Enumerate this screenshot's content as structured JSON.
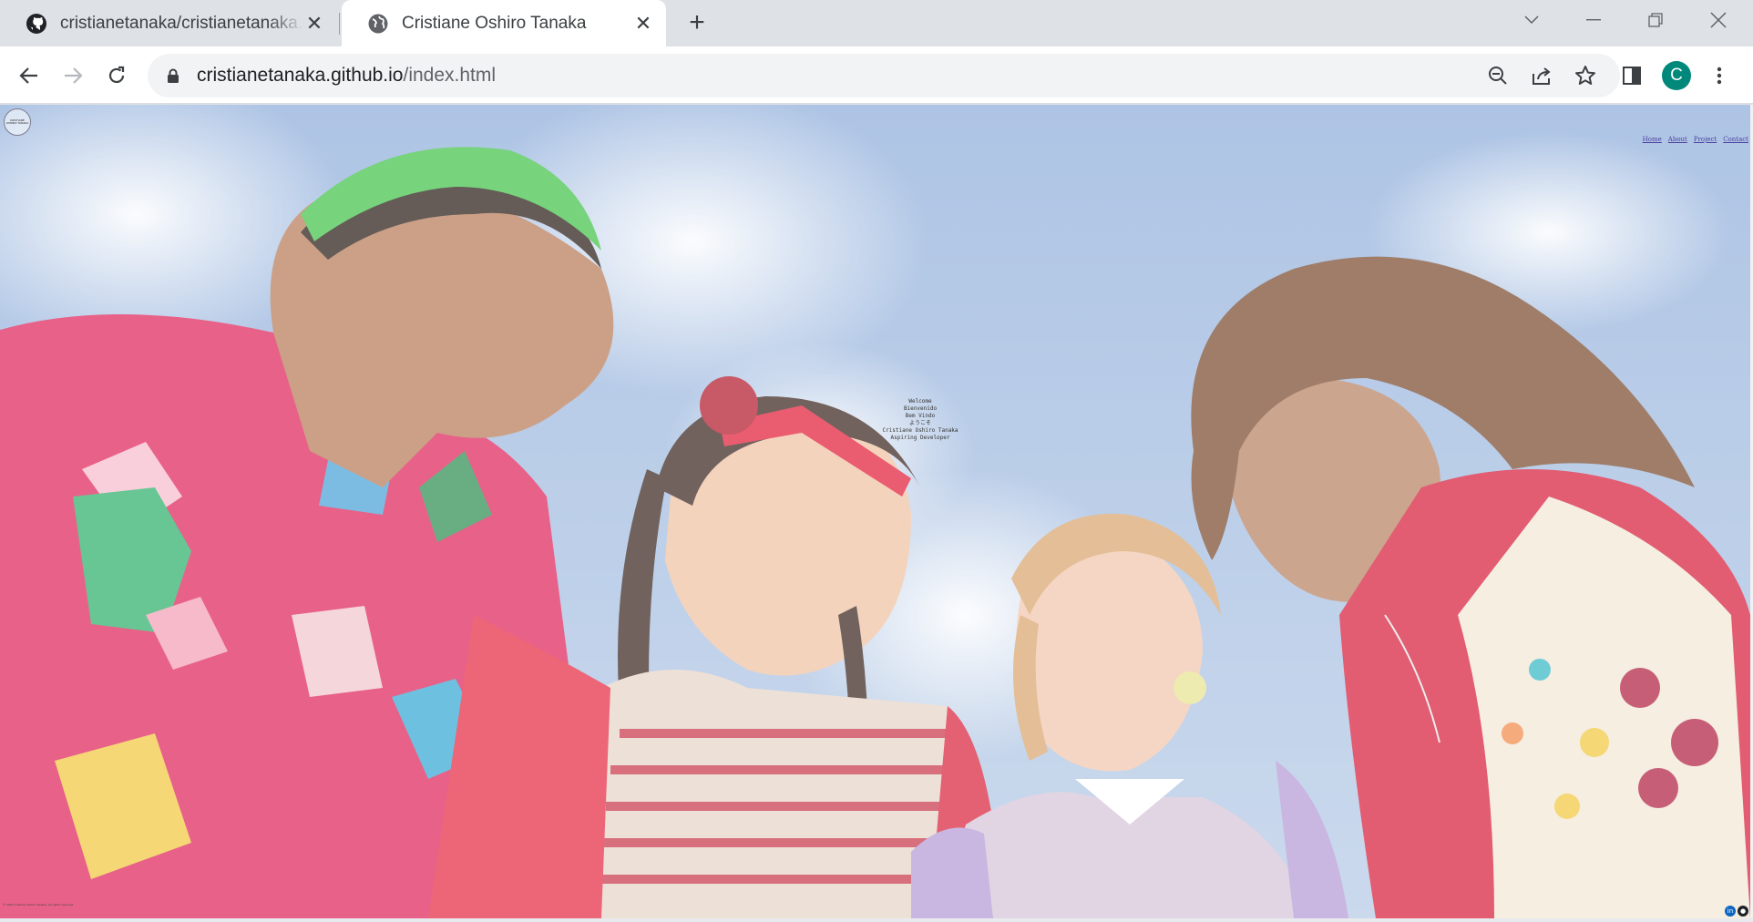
{
  "browser": {
    "tabs": [
      {
        "title": "cristianetanaka/cristianetanaka.github.io",
        "favicon": "github-icon",
        "active": false
      },
      {
        "title": "Cristiane Oshiro Tanaka",
        "favicon": "globe-icon",
        "active": true
      }
    ],
    "address": {
      "host": "cristianetanaka.github.io",
      "path": "/index.html"
    },
    "profile_initial": "C",
    "profile_color": "#00897b"
  },
  "page": {
    "logo_text": "CRISTIANE OSHIRO TANAKA",
    "nav": [
      "Home",
      "About",
      "Project",
      "Contact"
    ],
    "welcome": {
      "line1": "Welcome",
      "line2": "Bienvenido",
      "line3": "Bem Vindo",
      "line4": "ようこそ",
      "name": "Cristiane Oshiro Tanaka",
      "role": "Aspiring Developer"
    },
    "footer": "© 2022 Cristiane Oshiro Tanaka. All rights reserved.",
    "social": [
      "linkedin-icon",
      "github-icon"
    ],
    "link_color": "#4b3f9e"
  }
}
